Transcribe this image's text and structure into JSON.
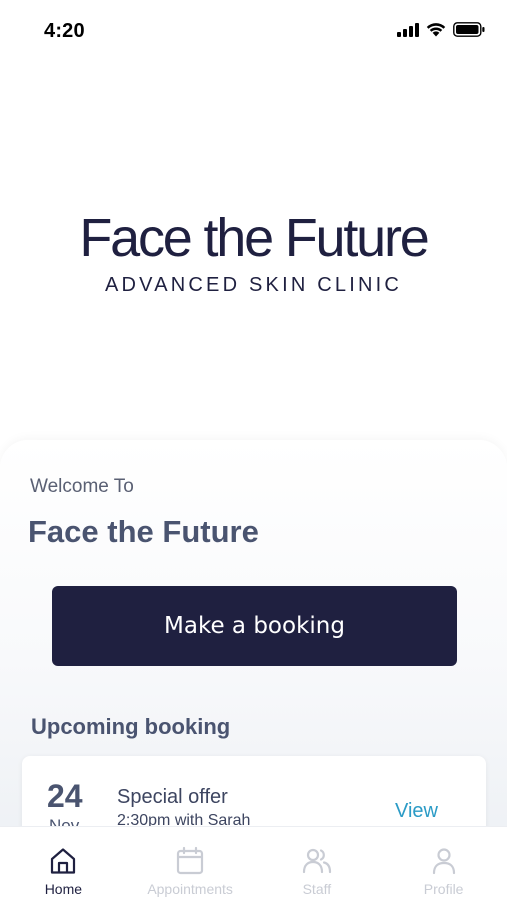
{
  "status_bar": {
    "time": "4:20",
    "icons": [
      "cellular-signal-icon",
      "wifi-icon",
      "battery-icon"
    ]
  },
  "logo": {
    "title": "Face the Future",
    "subtitle": "ADVANCED SKIN CLINIC"
  },
  "welcome": {
    "label": "Welcome To",
    "title": "Face the Future",
    "booking_button": "Make a booking"
  },
  "upcoming": {
    "heading": "Upcoming booking",
    "booking": {
      "day": "24",
      "month": "Nov",
      "title": "Special offer",
      "detail": "2:30pm with Sarah",
      "action": "View"
    }
  },
  "nav": {
    "items": [
      {
        "label": "Home",
        "icon": "home-icon",
        "active": true
      },
      {
        "label": "Appointments",
        "icon": "calendar-icon",
        "active": false
      },
      {
        "label": "Staff",
        "icon": "users-icon",
        "active": false
      },
      {
        "label": "Profile",
        "icon": "user-icon",
        "active": false
      }
    ]
  },
  "colors": {
    "brand_navy": "#1f2040",
    "heading_slate": "#4a5470",
    "link_blue": "#2b9bc6",
    "nav_inactive": "#c9ccd4"
  }
}
